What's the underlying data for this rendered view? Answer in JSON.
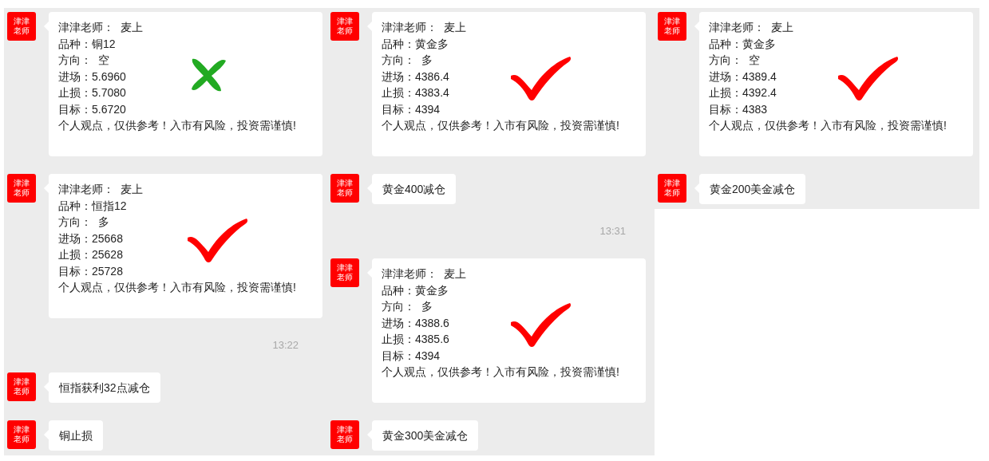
{
  "columns": [
    {
      "messages": [
        {
          "kind": "card",
          "avatar": [
            "津津",
            "老师"
          ],
          "lines": [
            "津津老师：  麦上",
            "品种：铜12",
            "方向：  空",
            "进场：5.6960",
            "止损：5.7080",
            "目标：5.6720",
            "个人观点，仅供参考！入市有风险，投资需谨慎!"
          ],
          "mark": {
            "kind": "cross"
          }
        },
        {
          "kind": "card",
          "avatar": [
            "津津",
            "老师"
          ],
          "lines": [
            "津津老师：  麦上",
            "品种：恒指12",
            "方向：  多",
            "进场：25668",
            "止损：25628",
            "目标：25728",
            "个人观点，仅供参考！入市有风险，投资需谨慎!"
          ],
          "mark": {
            "kind": "check"
          }
        },
        {
          "kind": "time",
          "text": "13:22"
        },
        {
          "kind": "text",
          "avatar": [
            "津津",
            "老师"
          ],
          "text": "恒指获利32点减仓"
        },
        {
          "kind": "text",
          "avatar": [
            "津津",
            "老师"
          ],
          "text": "铜止损"
        }
      ]
    },
    {
      "messages": [
        {
          "kind": "card",
          "avatar": [
            "津津",
            "老师"
          ],
          "lines": [
            "津津老师：  麦上",
            "品种：黄金多",
            "方向：  多",
            "进场：4386.4",
            "止损：4383.4",
            "目标：4394",
            "个人观点，仅供参考！入市有风险，投资需谨慎!"
          ],
          "mark": {
            "kind": "check"
          }
        },
        {
          "kind": "text",
          "avatar": [
            "津津",
            "老师"
          ],
          "text": "黄金400减仓"
        },
        {
          "kind": "time",
          "text": "13:31"
        },
        {
          "kind": "card",
          "avatar": [
            "津津",
            "老师"
          ],
          "lines": [
            "津津老师：  麦上",
            "品种：黄金多",
            "方向：  多",
            "进场：4388.6",
            "止损：4385.6",
            "目标：4394",
            "个人观点，仅供参考！入市有风险，投资需谨慎!"
          ],
          "mark": {
            "kind": "check"
          }
        },
        {
          "kind": "text",
          "avatar": [
            "津津",
            "老师"
          ],
          "text": "黄金300美金减仓"
        }
      ]
    },
    {
      "messages": [
        {
          "kind": "card",
          "avatar": [
            "津津",
            "老师"
          ],
          "lines": [
            "津津老师：  麦上",
            "品种：黄金多",
            "方向：  空",
            "进场：4389.4",
            "止损：4392.4",
            "目标：4383",
            "个人观点，仅供参考！入市有风险，投资需谨慎!"
          ],
          "mark": {
            "kind": "check"
          }
        },
        {
          "kind": "text",
          "avatar": [
            "津津",
            "老师"
          ],
          "text": "黄金200美金减仓"
        }
      ]
    }
  ]
}
